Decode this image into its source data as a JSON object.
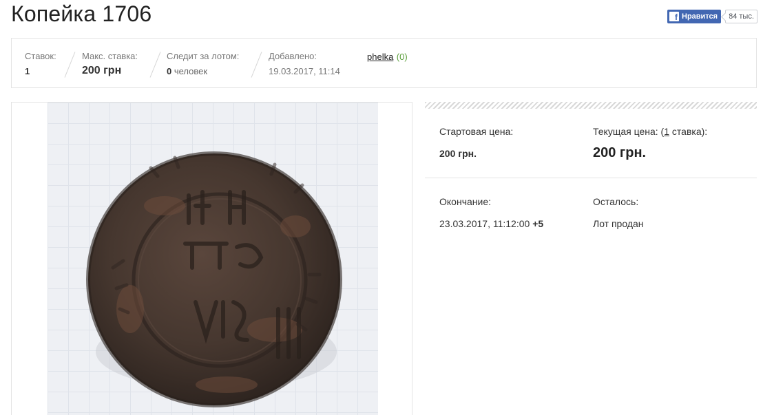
{
  "page": {
    "title": "Копейка 1706"
  },
  "facebook": {
    "like_label": "Нравится",
    "count": "84 тыс.",
    "logo": "f"
  },
  "stats": {
    "bids": {
      "label": "Ставок:",
      "value": "1"
    },
    "max_bid": {
      "label": "Макс. ставка:",
      "value": "200 грн"
    },
    "watchers": {
      "label": "Следит за лотом:",
      "count": "0",
      "unit": " человек"
    },
    "added": {
      "label": "Добавлено:",
      "value": "19.03.2017, 11:14"
    },
    "seller": {
      "name": "phelka",
      "rating": "(0)"
    }
  },
  "price": {
    "start_label": "Стартовая цена:",
    "start_value": "200 грн.",
    "current_label_prefix": "Текущая цена: (",
    "current_bids_link": "1",
    "current_label_suffix": " ставка):",
    "current_value": "200 грн."
  },
  "ending": {
    "end_label": "Окончание:",
    "end_value": "23.03.2017, 11:12:00",
    "end_tz": "+5",
    "remaining_label": "Осталось:",
    "remaining_value": "Лот продан"
  },
  "coin": {
    "colors": {
      "base": "#4a3a32",
      "rim": "#3a2e28",
      "rust": "#6b4a3a",
      "background": "#eef0f4"
    },
    "icon": "coin-photo"
  }
}
